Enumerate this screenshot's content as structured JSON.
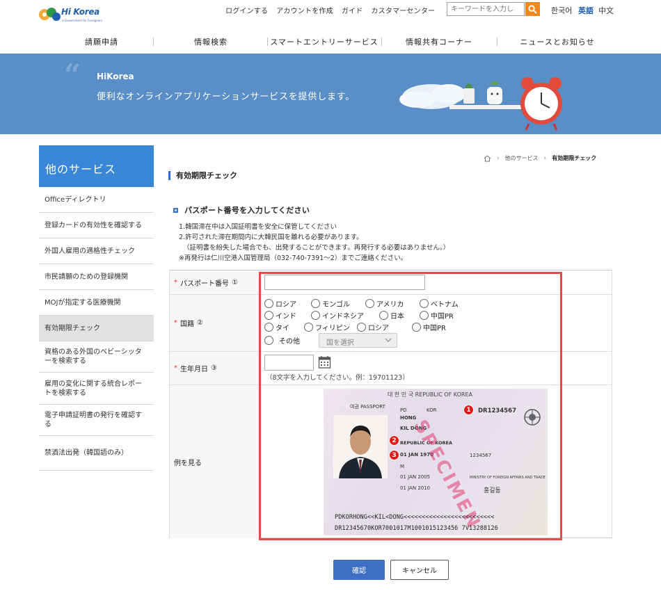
{
  "header": {
    "logo_text": "Hi Korea",
    "logo_sub": "e-Government for Foreigners",
    "utility_links": [
      "ログインする",
      "アカウントを作成",
      "ガイド",
      "カスタマーセンター"
    ],
    "search_placeholder": "キーワードを入力し",
    "languages": [
      "한국어",
      "英語",
      "中文"
    ]
  },
  "gnb": [
    "請願申請",
    "情報検索",
    "スマートエントリーサービス",
    "情報共有コーナー",
    "ニュースとお知らせ"
  ],
  "banner": {
    "title": "HiKorea",
    "subtitle": "便利なオンラインアプリケーションサービスを提供します。"
  },
  "sidebar": {
    "heading": "他のサービス",
    "items": [
      "Officeディレクトリ",
      "登録カードの有効性を確認する",
      "外国人雇用の適格性チェック",
      "市民請願のための登録機関",
      "MOJが指定する医療機関",
      "有効期限チェック",
      "資格のある外国のベビーシッターを検索する",
      "雇用の変化に関する統合レポートを検索する",
      "電子申請証明書の発行を確認する",
      "禁酒法出発（韓国語のみ）"
    ]
  },
  "breadcrumb": [
    "他のサービス",
    "有効期限チェック"
  ],
  "page_title": "有効期限チェック",
  "section_title": "パスポート番号を入力してください",
  "notes": [
    "1.韓国滞在中は入国証明書を安全に保管してください",
    "2.許可された滞在期間内に大韓民国を離れる必要があります。",
    "（証明書を紛失した場合でも、出発することができます。再発行する必要はありません。）",
    "※再発行は仁川空港入国管理局（032-740-7391～2）までご連絡ください。"
  ],
  "form": {
    "passport_label": "パスポート番号",
    "passport_num": "①",
    "nationality_label": "国籍",
    "nationality_num": "②",
    "nationality_options": [
      "ロシア",
      "モンゴル",
      "アメリカ",
      "ベトナム",
      "インド",
      "インドネシア",
      "日本",
      "中国PR",
      "タイ",
      "フィリピン",
      "ロシア",
      "中国PR",
      "その他"
    ],
    "country_select": "国を選択",
    "dob_label": "生年月日",
    "dob_num": "③",
    "dob_hint": "（8文字を入力してください。例：19701123）",
    "example_label": "例を見る"
  },
  "passport_sample": {
    "header": "대 한 민 국   REPUBLIC OF KOREA",
    "type_label": "여권 PASSPORT",
    "type": "PD",
    "country": "KOR",
    "number": "DR1234567",
    "surname": "HONG",
    "given": "KIL DONG",
    "nationality": "REPUBLIC OF KOREA",
    "dob": "01 JAN 1970",
    "personal_no": "1234567",
    "sex": "M",
    "issue": "01 JAN 2005",
    "expiry": "01 JAN 2010",
    "authority": "MINISTRY OF FOREIGN AFFAIRS AND TRADE",
    "korean_name": "홍길동",
    "mrz1": "PDKORHONG<<KIL<DONG<<<<<<<<<<<<<<<<<<<<<<<<<",
    "mrz2": "DR12345670KOR7001017M1001015123456 7V13288126",
    "specimen": "SPECIMEN",
    "badges": [
      "1",
      "2",
      "3"
    ]
  },
  "buttons": {
    "confirm": "確認",
    "cancel": "キャンセル"
  }
}
